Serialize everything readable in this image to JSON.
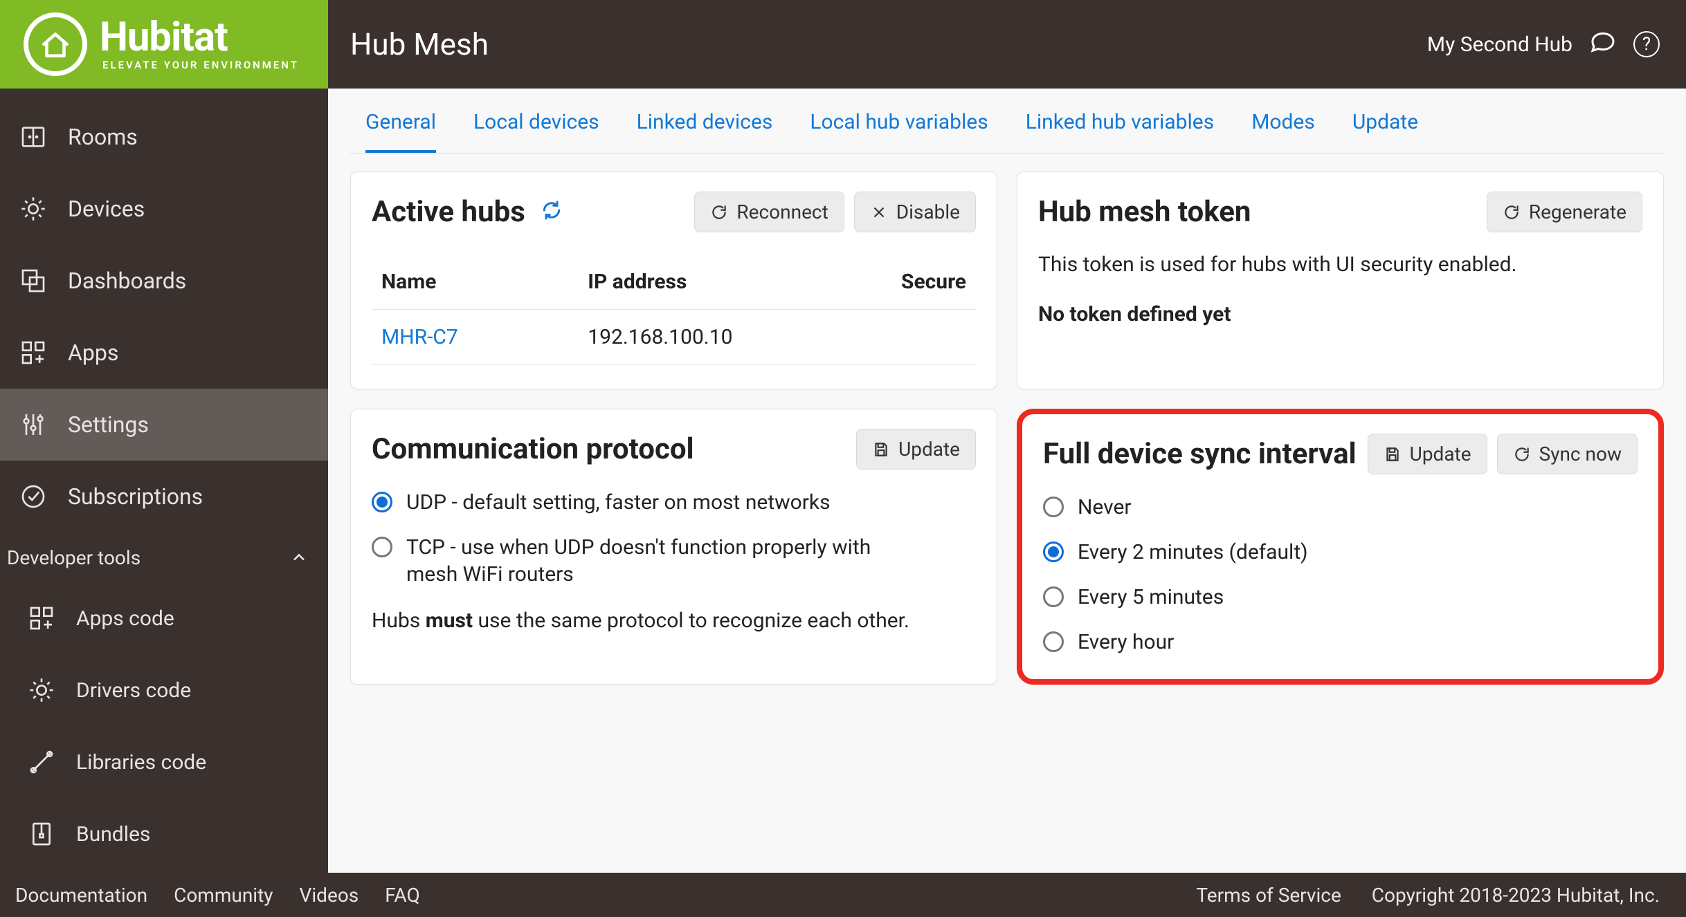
{
  "brand": {
    "name": "Hubitat",
    "tagline": "ELEVATE YOUR ENVIRONMENT"
  },
  "sidebar": {
    "items": [
      {
        "label": "Rooms"
      },
      {
        "label": "Devices"
      },
      {
        "label": "Dashboards"
      },
      {
        "label": "Apps"
      },
      {
        "label": "Settings"
      },
      {
        "label": "Subscriptions"
      }
    ],
    "devHeader": "Developer tools",
    "devItems": [
      {
        "label": "Apps code"
      },
      {
        "label": "Drivers code"
      },
      {
        "label": "Libraries code"
      },
      {
        "label": "Bundles"
      }
    ]
  },
  "header": {
    "title": "Hub Mesh",
    "hubName": "My Second Hub"
  },
  "tabs": [
    "General",
    "Local devices",
    "Linked devices",
    "Local hub variables",
    "Linked hub variables",
    "Modes",
    "Update"
  ],
  "activeHubs": {
    "title": "Active hubs",
    "reconnect": "Reconnect",
    "disable": "Disable",
    "columns": {
      "name": "Name",
      "ip": "IP address",
      "secure": "Secure"
    },
    "rows": [
      {
        "name": "MHR-C7",
        "ip": "192.168.100.10",
        "secure": ""
      }
    ]
  },
  "token": {
    "title": "Hub mesh token",
    "regenerate": "Regenerate",
    "desc": "This token is used for hubs with UI security enabled.",
    "status": "No token defined yet"
  },
  "protocol": {
    "title": "Communication protocol",
    "update": "Update",
    "options": [
      "UDP - default setting, faster on most networks",
      "TCP - use when UDP doesn't function properly with mesh WiFi routers"
    ],
    "selected": 0,
    "note_pre": "Hubs ",
    "note_bold": "must",
    "note_post": " use the same protocol to recognize each other."
  },
  "sync": {
    "title": "Full device sync interval",
    "update": "Update",
    "syncNow": "Sync now",
    "options": [
      "Never",
      "Every 2 minutes (default)",
      "Every 5 minutes",
      "Every hour"
    ],
    "selected": 1
  },
  "footer": {
    "links": [
      "Documentation",
      "Community",
      "Videos",
      "FAQ"
    ],
    "terms": "Terms of Service",
    "copyright": "Copyright 2018-2023 Hubitat, Inc."
  }
}
